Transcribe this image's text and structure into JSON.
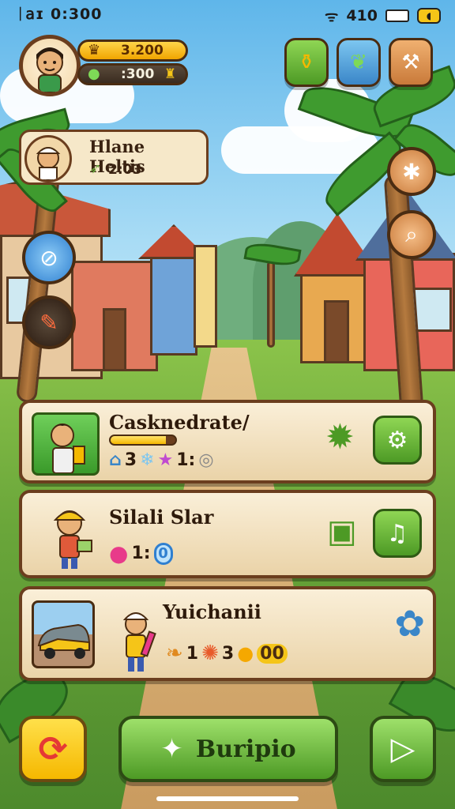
{
  "status_bar": {
    "left_text": "ᛁ𝖺ɪ 0:300",
    "signal": "ᯤ",
    "time": "410",
    "badge": "◖"
  },
  "player": {
    "gold": "3.200",
    "gems": ":300"
  },
  "quest": {
    "title": "Hlane Heltis",
    "value": "2:03"
  },
  "cards": [
    {
      "name": "Casknedrate/",
      "stats": [
        "3",
        "1:"
      ],
      "xp_fraction": 0.85
    },
    {
      "name": "Silali Slar",
      "stats": [
        "1:",
        "0"
      ]
    },
    {
      "name": "Yuichanii",
      "stats": [
        "1",
        "3",
        "00"
      ]
    }
  ],
  "bottom": {
    "main_label": "Buripio"
  },
  "colors": {
    "accent_green": "#5aa82c",
    "wood": "#6b3e1e",
    "gold": "#f5b800",
    "red_button": "#e53935"
  },
  "icons": {
    "top_buttons": [
      "jar-icon",
      "leaf-icon",
      "tools-icon"
    ],
    "side_buttons": [
      "compass-icon",
      "brush-icon",
      "star-icon",
      "search-icon"
    ]
  }
}
